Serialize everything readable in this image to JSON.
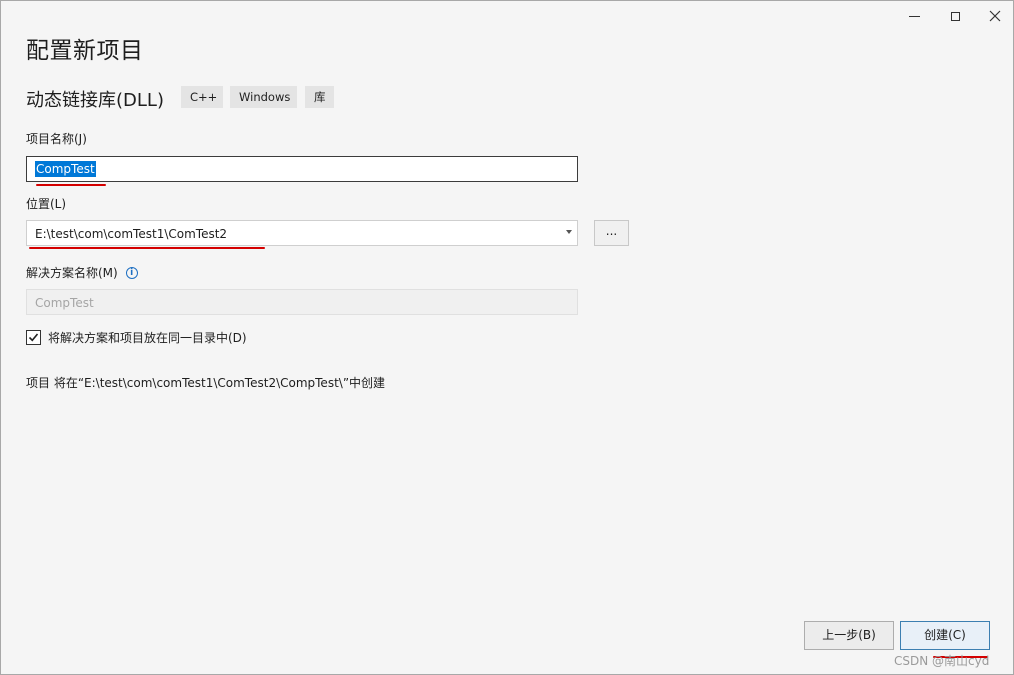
{
  "window": {
    "title": "配置新项目",
    "minimize_icon": "minimize-icon",
    "maximize_icon": "maximize-icon",
    "close_icon": "close-icon"
  },
  "template": {
    "name": "动态链接库(DLL)",
    "tags": [
      "C++",
      "Windows",
      "库"
    ]
  },
  "form": {
    "project_name_label": "项目名称(J)",
    "project_name_value": "CompTest",
    "location_label": "位置(L)",
    "location_value": "E:\\test\\com\\comTest1\\ComTest2",
    "browse_label": "...",
    "solution_name_label": "解决方案名称(M)",
    "solution_name_value": "CompTest",
    "same_dir_checkbox_label": "将解决方案和项目放在同一目录中(D)",
    "same_dir_checked": true,
    "creation_path_note": "项目 将在“E:\\test\\com\\comTest1\\ComTest2\\CompTest\\”中创建"
  },
  "footer": {
    "back_button": "上一步(B)",
    "create_button": "创建(C)"
  },
  "watermark": "CSDN @南山cyd",
  "colors": {
    "accent": "#0078d7",
    "annotation_red": "#d40000",
    "info_blue": "#1e6fc2"
  }
}
